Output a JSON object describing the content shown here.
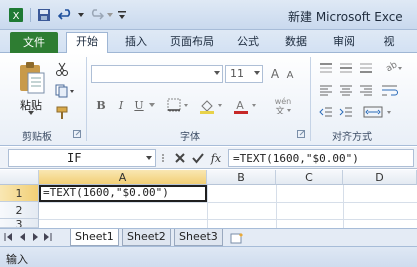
{
  "titlebar": {
    "title": "新建 Microsoft Exce"
  },
  "tabs": [
    "文件",
    "开始",
    "插入",
    "页面布局",
    "公式",
    "数据",
    "审阅",
    "视"
  ],
  "ribbon": {
    "clipboard": {
      "paste_label": "粘贴",
      "group_label": "剪贴板"
    },
    "font": {
      "font_name": "",
      "font_size": "11",
      "group_label": "字体",
      "bold": "B",
      "italic": "I",
      "underline": "U",
      "grow": "A",
      "shrink": "A",
      "phonetic": "wén"
    },
    "alignment": {
      "group_label": "对齐方式"
    }
  },
  "formula_bar": {
    "name_box": "IF",
    "formula": "=TEXT(1600,\"$0.00\")",
    "fx": "fx"
  },
  "grid": {
    "columns": [
      "A",
      "B",
      "C",
      "D"
    ],
    "rows": [
      "1",
      "2",
      "3"
    ],
    "cells": {
      "A1": "=TEXT(1600,\"$0.00\")"
    }
  },
  "sheets": [
    "Sheet1",
    "Sheet2",
    "Sheet3"
  ],
  "status": {
    "mode": "输入"
  },
  "colors": {
    "file_tab": "#2e7d32",
    "ribbon_bg": "#dfe9f5",
    "selected_header": "#f2cf76"
  }
}
